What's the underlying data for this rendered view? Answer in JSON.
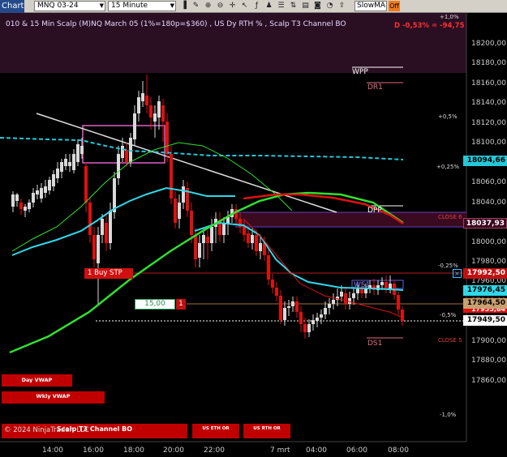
{
  "toolbar": {
    "chart_label": "Chart",
    "instrument": "MNQ 03-24",
    "interval": "15 Minute",
    "indicator_select": "SlowMA",
    "toggle": "Off"
  },
  "chart_title": "010 & 15 Min Scalp (M)NQ March 05 (1%=180p=$360) , US Dy RTH % , Scalp T3 Channel BO",
  "pl_text": "D -0,53% = -94,75",
  "copyright": "© 2024 NinjaTrader, LLC",
  "buttons": {
    "day_vwap": "Day VWAP",
    "wkly_vwap": "Wkly VWAP",
    "scalp_t3": "Scalp T3 Channel BO",
    "us_eth_or": "US ETH OR",
    "us_rth_or": "US RTH OR"
  },
  "price_axis": [
    "18200,00",
    "18180,00",
    "18160,00",
    "18140,00",
    "18120,00",
    "18100,00",
    "18080,00",
    "18060,00",
    "18040,00",
    "18020,00",
    "18000,00",
    "17980,00",
    "17960,00",
    "17940,00",
    "17920,00",
    "17900,00",
    "17880,00",
    "17860,00"
  ],
  "time_axis": [
    "14:00",
    "16:00",
    "18:00",
    "20:00",
    "22:00",
    "7 mrt",
    "04:00",
    "06:00",
    "08:00"
  ],
  "price_tags": {
    "slow_ma": "18094,66",
    "dpp_zone": "18037,93",
    "buy_stop": "17992,50",
    "fast_ma": "17976,45",
    "level_a": "17964,50",
    "level_b": "17955,84",
    "last": "17949,50"
  },
  "levels": {
    "wpp": "WPP",
    "dr1": "DR1",
    "dpp": "DPP",
    "ws1": "WS1",
    "ds1": "DS1"
  },
  "pct_labels": {
    "p1": "+1,0%",
    "p05": "+0,5%",
    "p025": "+0,25%",
    "m025": "-0,25%",
    "m05": "-0,5%",
    "m1": "-1,0%"
  },
  "close_labels": {
    "close6": "CLOSE 6",
    "close5": "CLOSE 5"
  },
  "order": {
    "buy_stp": "1  Buy STP",
    "price": "15,00",
    "qty": "1",
    "cancel": "×"
  },
  "colors": {
    "background": "#000000",
    "header_band": "#2a0e22",
    "bull_candle": "#d9d9d9",
    "bear_candle": "#e01010",
    "slow_ma": "#25c8d8",
    "fast_ma": "#30d8e8",
    "green_ma": "#30e030",
    "red_ma": "#e01010",
    "dpp_zone": "#3a0a20"
  }
}
